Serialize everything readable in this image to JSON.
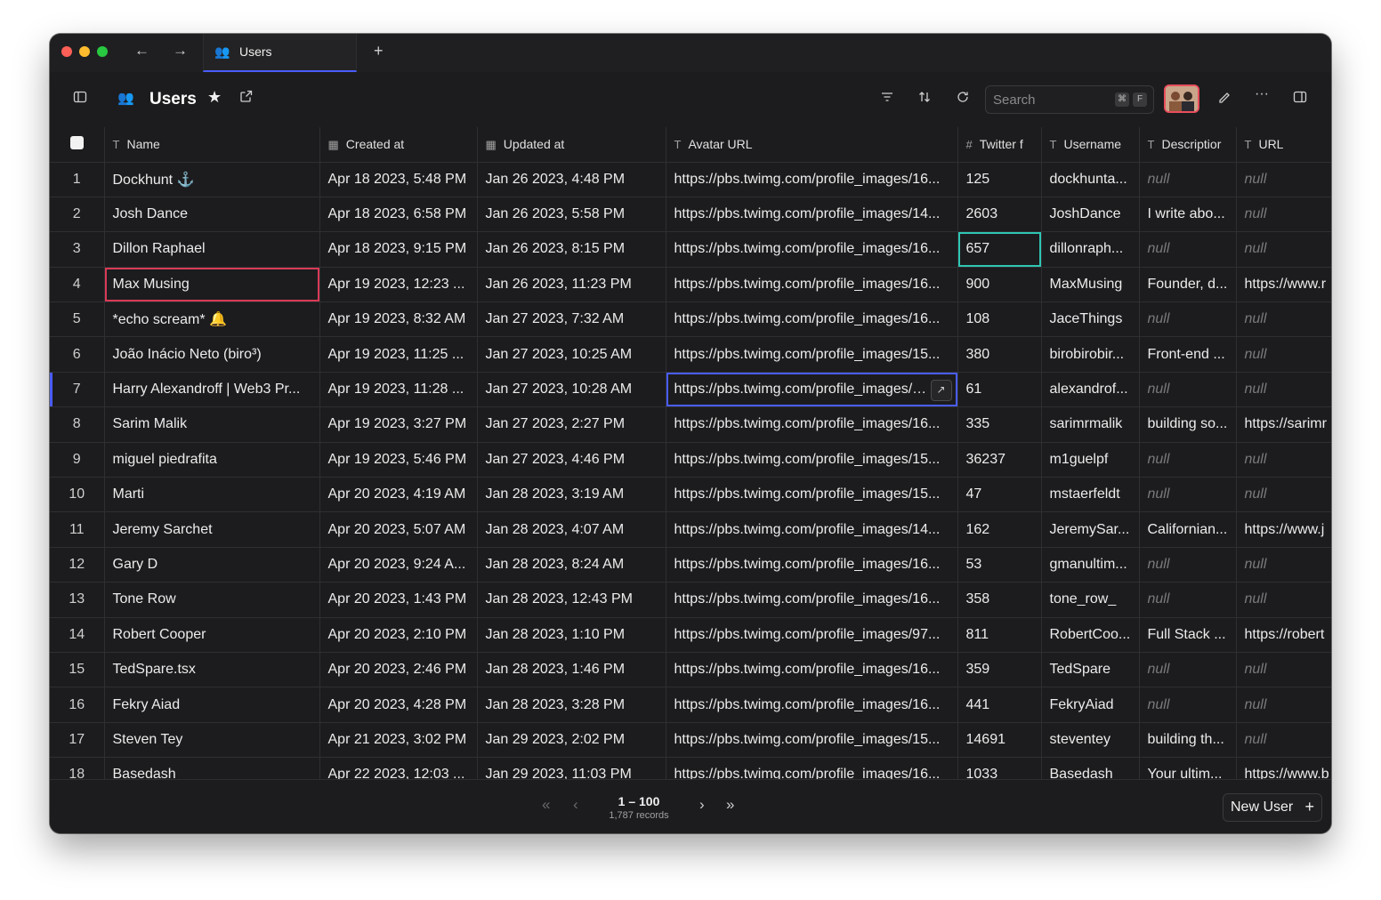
{
  "tab": {
    "label": "Users",
    "icon": "👥"
  },
  "toolbar": {
    "title": "Users",
    "search_placeholder": "Search",
    "kbd_cmd": "⌘",
    "kbd_key": "F"
  },
  "columns": [
    {
      "label": "Name",
      "icon": "T"
    },
    {
      "label": "Created at",
      "icon": "▦"
    },
    {
      "label": "Updated at",
      "icon": "▦"
    },
    {
      "label": "Avatar URL",
      "icon": "T"
    },
    {
      "label": "Twitter f",
      "icon": "#"
    },
    {
      "label": "Username",
      "icon": "T"
    },
    {
      "label": "Descriptior",
      "icon": "T"
    },
    {
      "label": "URL",
      "icon": "T"
    }
  ],
  "rows": [
    {
      "n": "1",
      "name": "Dockhunt ⚓",
      "created": "Apr 18 2023, 5:48 PM",
      "updated": "Jan 26 2023, 4:48 PM",
      "avatar": "https://pbs.twimg.com/profile_images/16...",
      "twitter": "125",
      "username": "dockhunta...",
      "desc": "null",
      "url": "null"
    },
    {
      "n": "2",
      "name": "Josh Dance",
      "created": "Apr 18 2023, 6:58 PM",
      "updated": "Jan 26 2023, 5:58 PM",
      "avatar": "https://pbs.twimg.com/profile_images/14...",
      "twitter": "2603",
      "username": "JoshDance",
      "desc": "I write abo...",
      "url": "null"
    },
    {
      "n": "3",
      "name": "Dillon Raphael",
      "created": "Apr 18 2023, 9:15 PM",
      "updated": "Jan 26 2023, 8:15 PM",
      "avatar": "https://pbs.twimg.com/profile_images/16...",
      "twitter": "657",
      "username": "dillonraph...",
      "desc": "null",
      "url": "null"
    },
    {
      "n": "4",
      "name": "Max Musing",
      "created": "Apr 19 2023, 12:23 ...",
      "updated": "Jan 26 2023, 11:23 PM",
      "avatar": "https://pbs.twimg.com/profile_images/16...",
      "twitter": "900",
      "username": "MaxMusing",
      "desc": "Founder, d...",
      "url": "https://www.r"
    },
    {
      "n": "5",
      "name": "*echo scream* 🔔",
      "created": "Apr 19 2023, 8:32 AM",
      "updated": "Jan 27 2023, 7:32 AM",
      "avatar": "https://pbs.twimg.com/profile_images/16...",
      "twitter": "108",
      "username": "JaceThings",
      "desc": "null",
      "url": "null"
    },
    {
      "n": "6",
      "name": "João Inácio Neto (biro³)",
      "created": "Apr 19 2023, 11:25 ...",
      "updated": "Jan 27 2023, 10:25 AM",
      "avatar": "https://pbs.twimg.com/profile_images/15...",
      "twitter": "380",
      "username": "birobirobir...",
      "desc": "Front-end ...",
      "url": "null"
    },
    {
      "n": "7",
      "name": "Harry Alexandroff | Web3 Pr...",
      "created": "Apr 19 2023, 11:28 ...",
      "updated": "Jan 27 2023, 10:28 AM",
      "avatar": "https://pbs.twimg.com/profile_images/1€",
      "twitter": "61",
      "username": "alexandrof...",
      "desc": "null",
      "url": "null"
    },
    {
      "n": "8",
      "name": "Sarim Malik",
      "created": "Apr 19 2023, 3:27 PM",
      "updated": "Jan 27 2023, 2:27 PM",
      "avatar": "https://pbs.twimg.com/profile_images/16...",
      "twitter": "335",
      "username": "sarimrmalik",
      "desc": "building so...",
      "url": "https://sarimr"
    },
    {
      "n": "9",
      "name": "miguel piedrafita",
      "created": "Apr 19 2023, 5:46 PM",
      "updated": "Jan 27 2023, 4:46 PM",
      "avatar": "https://pbs.twimg.com/profile_images/15...",
      "twitter": "36237",
      "username": "m1guelpf",
      "desc": "null",
      "url": "null"
    },
    {
      "n": "10",
      "name": "Marti",
      "created": "Apr 20 2023, 4:19 AM",
      "updated": "Jan 28 2023, 3:19 AM",
      "avatar": "https://pbs.twimg.com/profile_images/15...",
      "twitter": "47",
      "username": "mstaerfeldt",
      "desc": "null",
      "url": "null"
    },
    {
      "n": "11",
      "name": "Jeremy Sarchet",
      "created": "Apr 20 2023, 5:07 AM",
      "updated": "Jan 28 2023, 4:07 AM",
      "avatar": "https://pbs.twimg.com/profile_images/14...",
      "twitter": "162",
      "username": "JeremySar...",
      "desc": "Californian...",
      "url": "https://www.j"
    },
    {
      "n": "12",
      "name": "Gary D",
      "created": "Apr 20 2023, 9:24 A...",
      "updated": "Jan 28 2023, 8:24 AM",
      "avatar": "https://pbs.twimg.com/profile_images/16...",
      "twitter": "53",
      "username": "gmanultim...",
      "desc": "null",
      "url": "null"
    },
    {
      "n": "13",
      "name": "Tone Row",
      "created": "Apr 20 2023, 1:43 PM",
      "updated": "Jan 28 2023, 12:43 PM",
      "avatar": "https://pbs.twimg.com/profile_images/16...",
      "twitter": "358",
      "username": "tone_row_",
      "desc": "null",
      "url": "null"
    },
    {
      "n": "14",
      "name": "Robert Cooper",
      "created": "Apr 20 2023, 2:10 PM",
      "updated": "Jan 28 2023, 1:10 PM",
      "avatar": "https://pbs.twimg.com/profile_images/97...",
      "twitter": "811",
      "username": "RobertCoo...",
      "desc": "Full Stack ...",
      "url": "https://robert"
    },
    {
      "n": "15",
      "name": "TedSpare.tsx",
      "created": "Apr 20 2023, 2:46 PM",
      "updated": "Jan 28 2023, 1:46 PM",
      "avatar": "https://pbs.twimg.com/profile_images/16...",
      "twitter": "359",
      "username": "TedSpare",
      "desc": "null",
      "url": "null"
    },
    {
      "n": "16",
      "name": "Fekry Aiad",
      "created": "Apr 20 2023, 4:28 PM",
      "updated": "Jan 28 2023, 3:28 PM",
      "avatar": "https://pbs.twimg.com/profile_images/16...",
      "twitter": "441",
      "username": "FekryAiad",
      "desc": "null",
      "url": "null"
    },
    {
      "n": "17",
      "name": "Steven Tey",
      "created": "Apr 21 2023, 3:02 PM",
      "updated": "Jan 29 2023, 2:02 PM",
      "avatar": "https://pbs.twimg.com/profile_images/15...",
      "twitter": "14691",
      "username": "steventey",
      "desc": "building th...",
      "url": "null"
    },
    {
      "n": "18",
      "name": "Basedash",
      "created": "Apr 22 2023, 12:03 ...",
      "updated": "Jan 29 2023, 11:03 PM",
      "avatar": "https://pbs.twimg.com/profile_images/16...",
      "twitter": "1033",
      "username": "Basedash",
      "desc": "Your ultim...",
      "url": "https://www.b"
    }
  ],
  "footer": {
    "range": "1 – 100",
    "records": "1,787 records",
    "new_button": "New User"
  }
}
